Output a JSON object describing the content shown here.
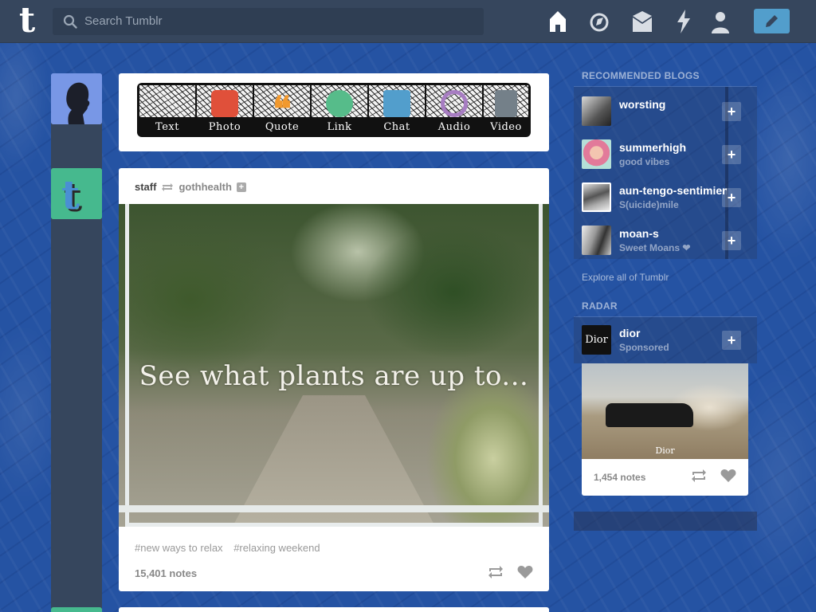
{
  "header": {
    "logo": "t",
    "search_placeholder": "Search Tumblr",
    "nav_icons": [
      "home-icon",
      "explore-icon",
      "inbox-icon",
      "activity-icon",
      "account-icon"
    ],
    "compose_icon": "pencil-icon"
  },
  "post_types": [
    {
      "label": "Text",
      "color": "#333333"
    },
    {
      "label": "Photo",
      "color": "#e0503a"
    },
    {
      "label": "Quote",
      "color": "#f2992e"
    },
    {
      "label": "Link",
      "color": "#56bc8a"
    },
    {
      "label": "Chat",
      "color": "#529ecc"
    },
    {
      "label": "Audio",
      "color": "#a77dc2"
    },
    {
      "label": "Video",
      "color": "#748089"
    }
  ],
  "post": {
    "author": "staff",
    "reblogged_from": "gothhealth",
    "image_caption": "See what plants are up to...",
    "tags": [
      "#new ways to relax",
      "#relaxing weekend"
    ],
    "notes": "15,401 notes"
  },
  "sidebar": {
    "recommended_heading": "RECOMMENDED BLOGS",
    "blogs": [
      {
        "name": "worsting",
        "subtitle": ""
      },
      {
        "name": "summerhigh",
        "subtitle": "good vibes"
      },
      {
        "name": "aun-tengo-sentimientos",
        "subtitle": "S(uicide)mile"
      },
      {
        "name": "moan-s",
        "subtitle": "Sweet Moans ❤"
      }
    ],
    "explore_link": "Explore all of Tumblr",
    "radar_heading": "RADAR",
    "radar": {
      "name": "dior",
      "subtitle": "Sponsored",
      "avatar_text": "Dior",
      "image_text": "Dior",
      "notes": "1,454 notes"
    }
  }
}
